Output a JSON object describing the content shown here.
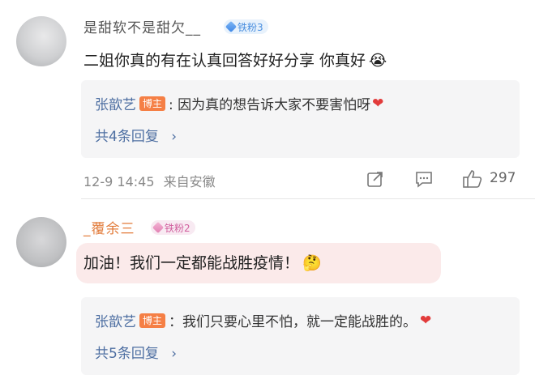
{
  "comments": [
    {
      "username": "是甜软不是甜欠__",
      "fan_badge": "铁粉3",
      "text": "二姐你真的有在认真回答好好分享 你真好",
      "emoji": "😭",
      "reply": {
        "author": "张歆艺",
        "host_label": "博主",
        "text": ": 因为真的想告诉大家不要害怕呀",
        "heart": "❤"
      },
      "reply_count": "共4条回复",
      "chevron": "›",
      "timestamp": "12-9 14:45",
      "location": "来自安徽",
      "like_count": "297"
    },
    {
      "username": "_覆余三",
      "fan_badge": "铁粉2",
      "text": "加油！我们一定都能战胜疫情！",
      "emoji": "🤔",
      "reply": {
        "author": "张歆艺",
        "host_label": "博主",
        "text": "：我们只要心里不怕，就一定能战胜的。",
        "heart": "❤"
      },
      "reply_count": "共5条回复",
      "chevron": "›"
    }
  ],
  "icons": [
    "share-icon",
    "comment-icon",
    "like-icon",
    "diamond-icon"
  ]
}
